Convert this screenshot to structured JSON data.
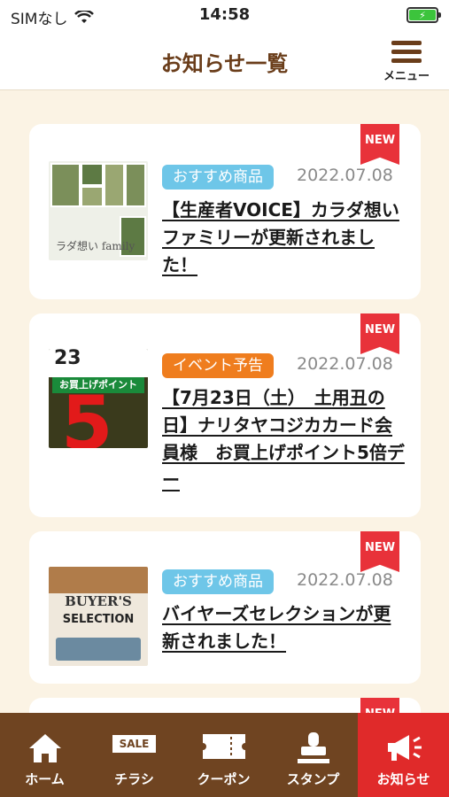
{
  "status_bar": {
    "carrier": "SIMなし",
    "time": "14:58",
    "battery_icon": "battery-charging-icon"
  },
  "header": {
    "title": "お知らせ一覧",
    "menu_label": "メニュー"
  },
  "news": [
    {
      "badge": "NEW",
      "tag": "おすすめ商品",
      "tag_color": "#6ec6e8",
      "date": "2022.07.08",
      "title": "【生産者VOICE】カラダ想いファミリーが更新されました！",
      "thumb_text": "ラダ想い family"
    },
    {
      "badge": "NEW",
      "tag": "イベント予告",
      "tag_color": "#ef7d1e",
      "date": "2022.07.08",
      "title": "【7月23日（土）　土用丑の日】ナリタヤコジカカード会員様　お買上げポイント5倍デー",
      "thumb_top": "23",
      "thumb_band": "お買上げポイント",
      "thumb_big": "5"
    },
    {
      "badge": "NEW",
      "tag": "おすすめ商品",
      "tag_color": "#6ec6e8",
      "date": "2022.07.08",
      "title": "バイヤーズセレクションが更新されました！",
      "thumb_line1": "BUYER'S",
      "thumb_line2": "SELECTION"
    },
    {
      "badge": "NEW"
    }
  ],
  "bottom_nav": [
    {
      "label": "ホーム",
      "icon": "home-icon"
    },
    {
      "label": "チラシ",
      "icon": "flyer-sale-icon",
      "icon_text": "SALE"
    },
    {
      "label": "クーポン",
      "icon": "coupon-ticket-icon"
    },
    {
      "label": "スタンプ",
      "icon": "stamp-icon"
    },
    {
      "label": "お知らせ",
      "icon": "megaphone-icon",
      "active": true
    }
  ],
  "colors": {
    "brand_brown": "#6f4421",
    "title_brown": "#6a3d1a",
    "new_red": "#e8323a",
    "active_red": "#e02a2a",
    "background": "#fbf3e4"
  }
}
